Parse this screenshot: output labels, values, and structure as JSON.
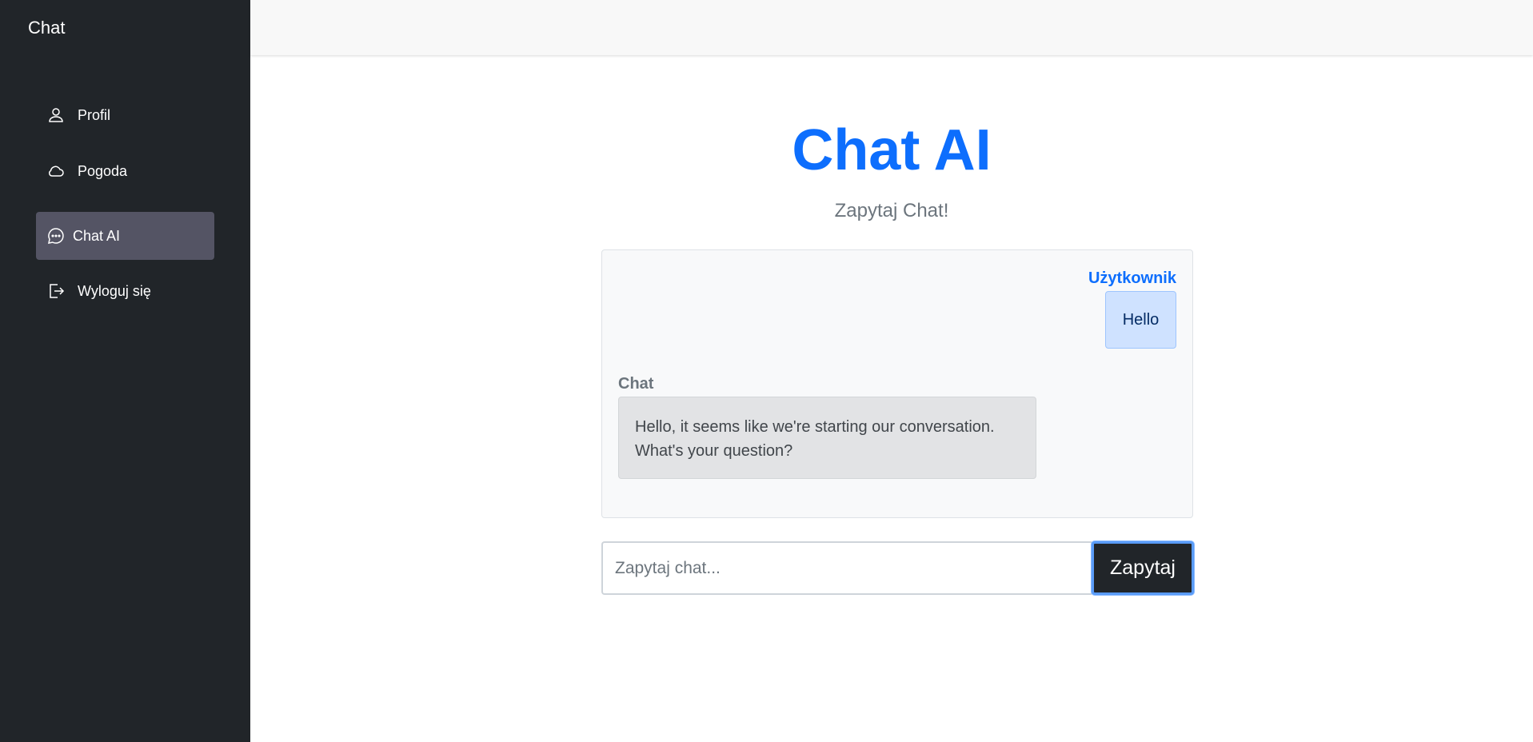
{
  "sidebar": {
    "brand": "Chat",
    "items": [
      {
        "label": "Profil",
        "icon": "person-icon"
      },
      {
        "label": "Pogoda",
        "icon": "cloud-icon"
      },
      {
        "label": "Chat AI",
        "icon": "chat-dots-icon",
        "active": true
      },
      {
        "label": "Wyloguj się",
        "icon": "logout-icon"
      }
    ]
  },
  "main": {
    "title": "Chat AI",
    "subtitle": "Zapytaj Chat!"
  },
  "chat": {
    "messages": [
      {
        "sender": "Użytkownik",
        "text": "Hello"
      },
      {
        "sender": "Chat",
        "text": "Hello, it seems like we're starting our conversation. What's your question?"
      }
    ]
  },
  "input": {
    "placeholder": "Zapytaj chat...",
    "value": "",
    "button_label": "Zapytaj"
  },
  "colors": {
    "sidebar_bg": "#212529",
    "accent": "#0d6efd",
    "active_item_bg": "#545464"
  }
}
